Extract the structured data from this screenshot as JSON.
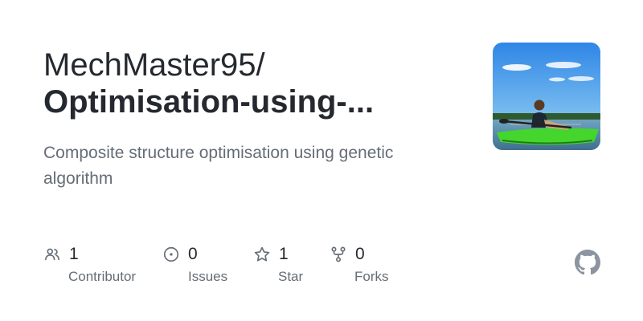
{
  "repo": {
    "owner": "MechMaster95/",
    "name": "Optimisation-using-...",
    "description": "Composite structure optimisation using genetic algorithm"
  },
  "avatar": {
    "icon": "person-in-kayak-photo"
  },
  "stats": [
    {
      "icon": "people-icon",
      "value": "1",
      "label": "Contributor"
    },
    {
      "icon": "issue-opened-icon",
      "value": "0",
      "label": "Issues"
    },
    {
      "icon": "star-icon",
      "value": "1",
      "label": "Star"
    },
    {
      "icon": "repo-forked-icon",
      "value": "0",
      "label": "Forks"
    }
  ],
  "brand": {
    "icon": "github-mark-icon"
  },
  "colors": {
    "text_primary": "#24292f",
    "text_muted": "#656d76",
    "icon_gray": "#656d76",
    "kayak_green": "#44d62c"
  }
}
